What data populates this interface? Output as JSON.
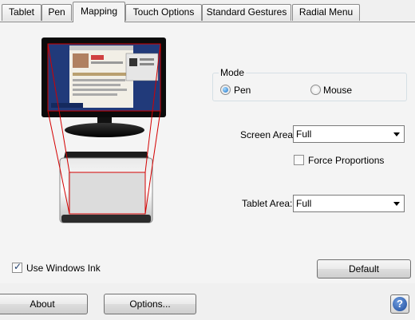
{
  "tabs": [
    {
      "label": "Tablet"
    },
    {
      "label": "Pen"
    },
    {
      "label": "Mapping"
    },
    {
      "label": "Touch Options"
    },
    {
      "label": "Standard Gestures"
    },
    {
      "label": "Radial Menu"
    }
  ],
  "mode": {
    "title": "Mode",
    "options": [
      {
        "label": "Pen",
        "selected": true
      },
      {
        "label": "Mouse",
        "selected": false
      }
    ]
  },
  "screen_area": {
    "label": "Screen Area:",
    "value": "Full"
  },
  "force_proportions": {
    "label": "Force Proportions",
    "checked": false
  },
  "tablet_area": {
    "label": "Tablet Area:",
    "value": "Full"
  },
  "use_windows_ink": {
    "label": "Use Windows Ink",
    "checked": true
  },
  "buttons": {
    "default": "Default",
    "about": "About",
    "options": "Options...",
    "help": "?"
  },
  "colors": {
    "mapping_lines": "#d40000",
    "screen_blue": "#213a7a",
    "radio_selected": "#1f6fc4"
  }
}
